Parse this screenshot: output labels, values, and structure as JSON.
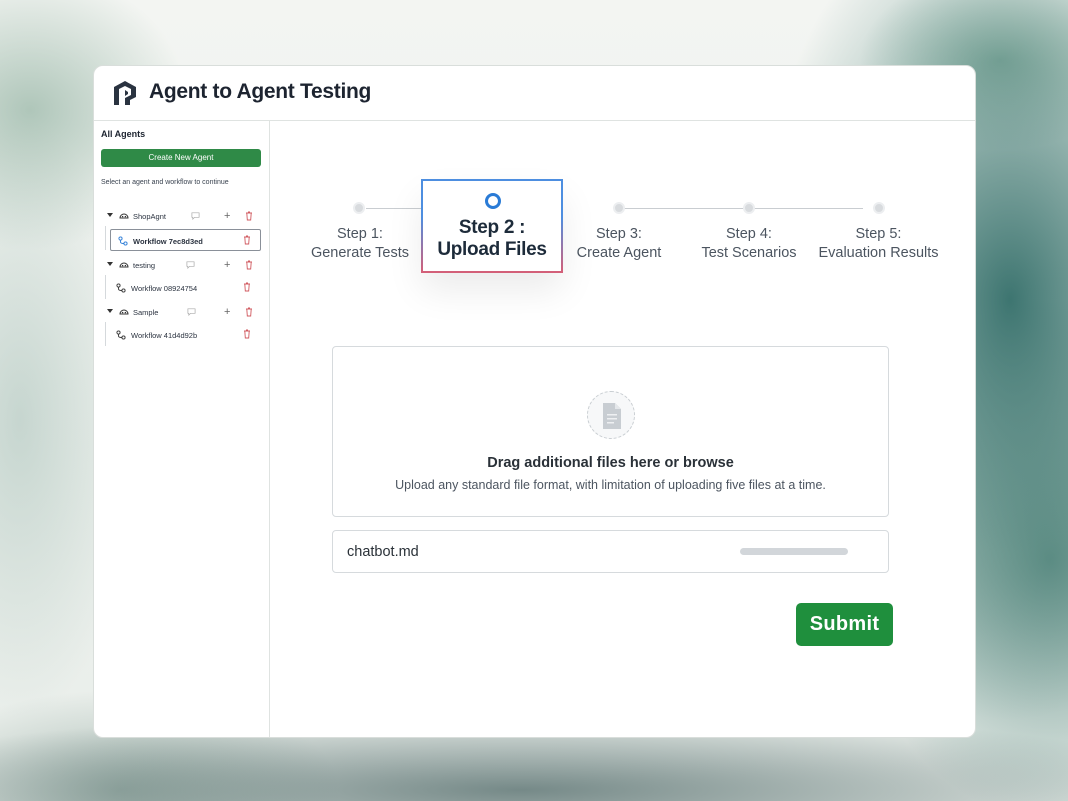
{
  "app": {
    "title": "Agent to Agent Testing"
  },
  "sidebar": {
    "title": "All Agents",
    "create_button": "Create New Agent",
    "hint": "Select an agent and workflow to continue",
    "agents": [
      {
        "name": "ShopAgnt",
        "workflow": "Workflow 7ec8d3ed",
        "selected": true
      },
      {
        "name": "testing",
        "workflow": "Workflow 08924754",
        "selected": false
      },
      {
        "name": "Sample",
        "workflow": "Workflow 41d4d92b",
        "selected": false
      }
    ]
  },
  "steps": {
    "items": [
      {
        "line1": "Step 1:",
        "line2": "Generate Tests"
      },
      {
        "line1": "Step 2 :",
        "line2": "Upload Files"
      },
      {
        "line1": "Step 3:",
        "line2": "Create Agent"
      },
      {
        "line1": "Step 4:",
        "line2": "Test Scenarios"
      },
      {
        "line1": "Step 5:",
        "line2": "Evaluation Results"
      }
    ],
    "active_index": 1
  },
  "upload": {
    "title": "Drag additional files here or browse",
    "subtitle": "Upload any standard file format, with limitation of uploading five files at a time.",
    "file_icon": "document-icon"
  },
  "files": [
    {
      "name": "chatbot.md",
      "progress": 1.0
    }
  ],
  "submit_label": "Submit",
  "colors": {
    "accent_green": "#1f8f3d",
    "sidebar_button_green": "#2f8a47",
    "active_step_blue": "#2a7bd6",
    "trash_red": "#d0595f"
  }
}
